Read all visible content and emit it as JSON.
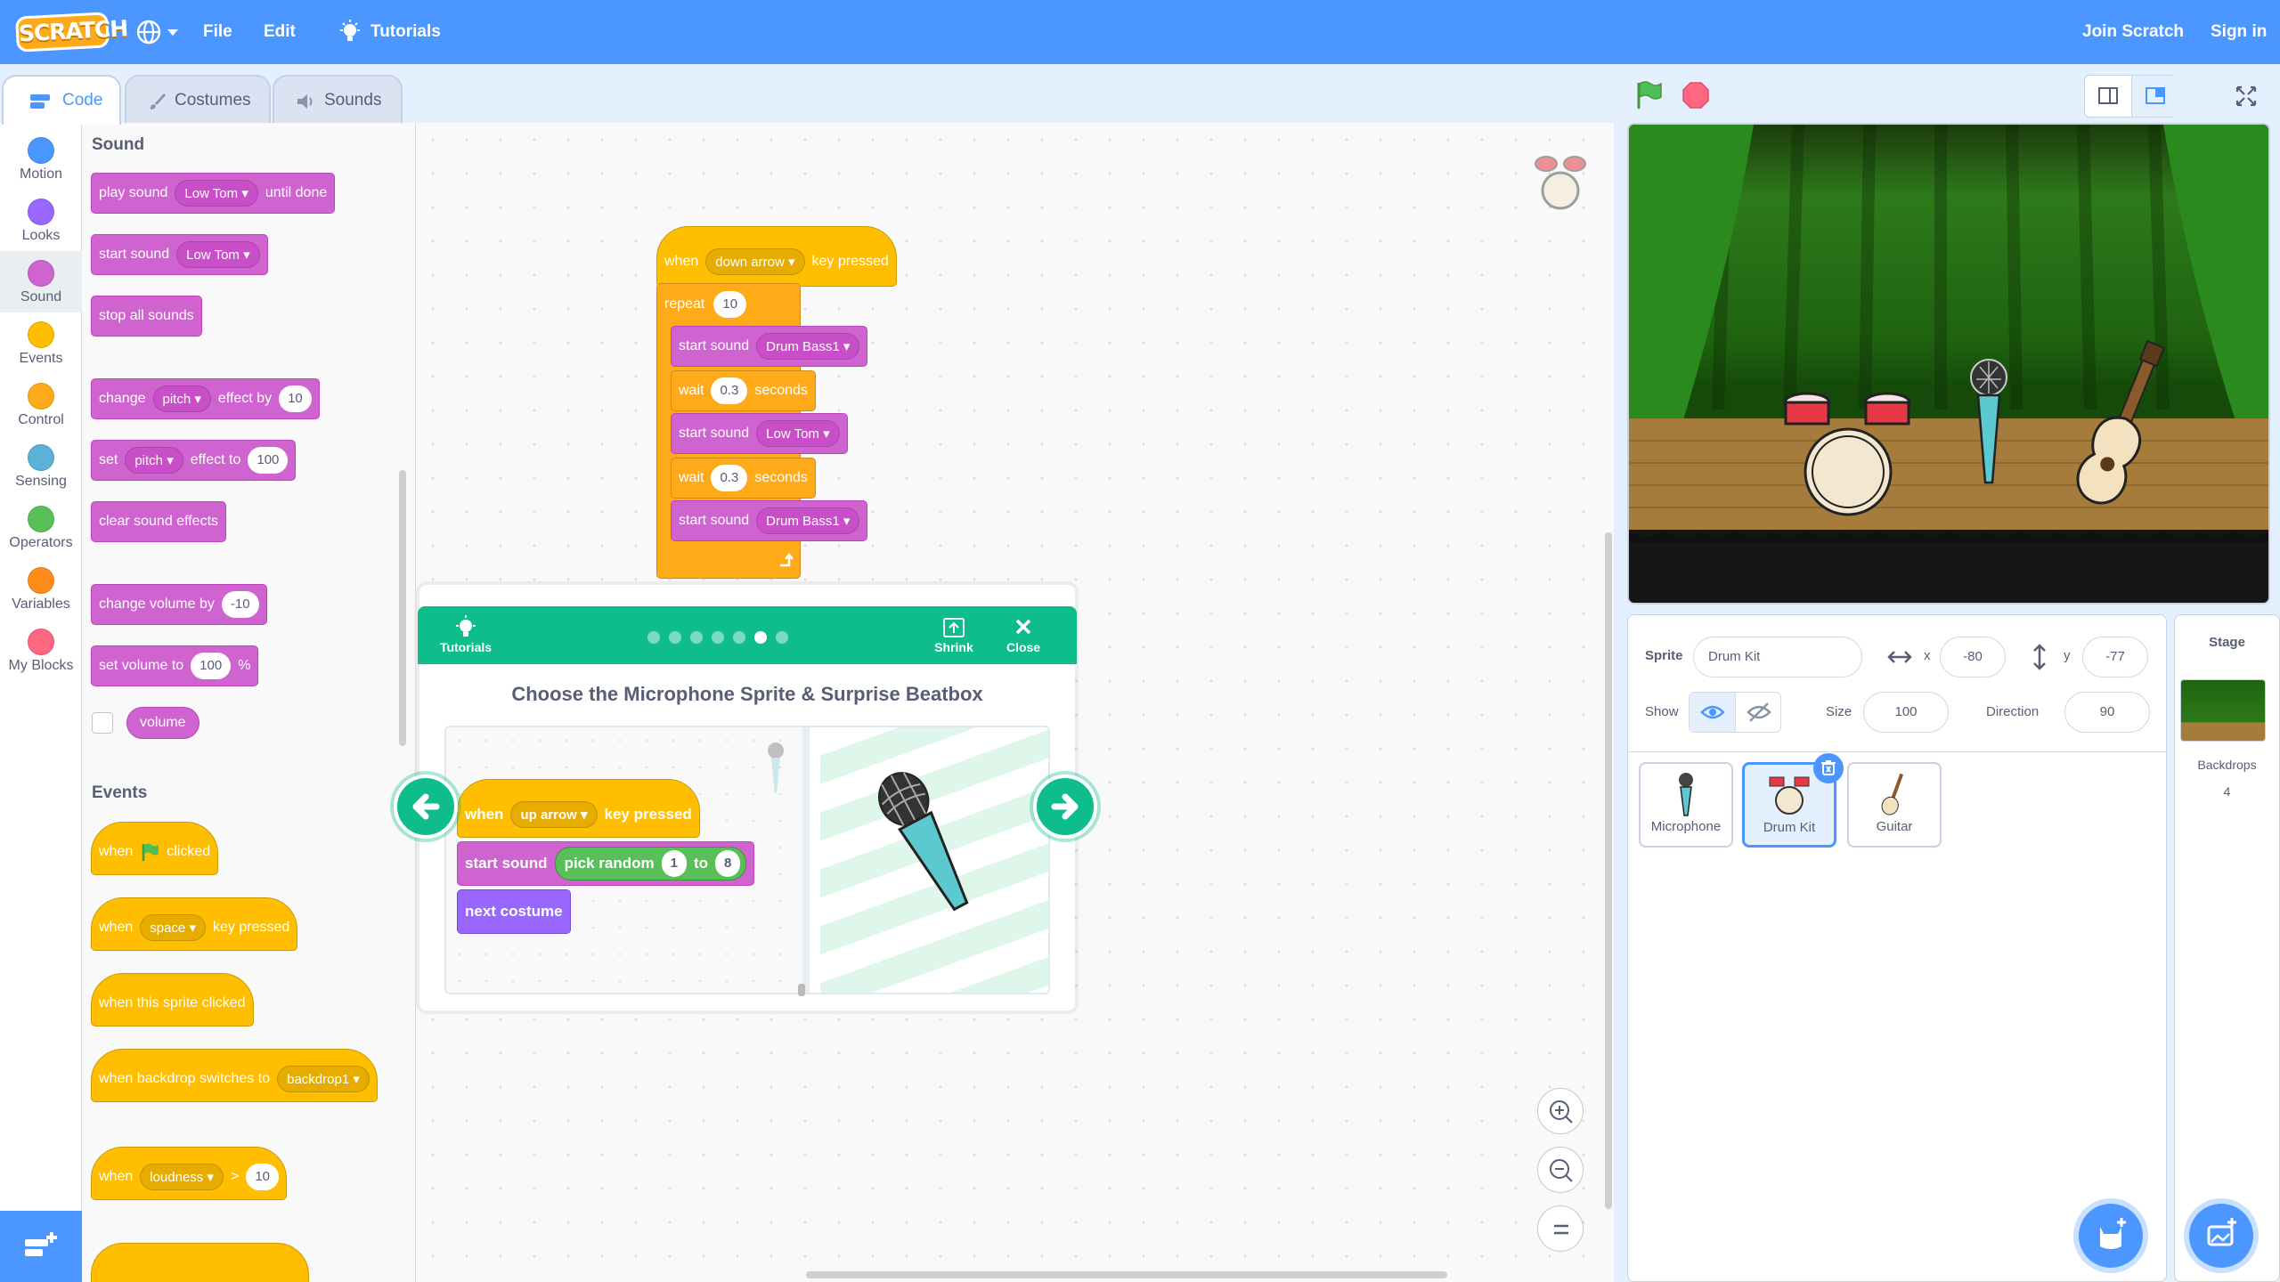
{
  "menu": {
    "file": "File",
    "edit": "Edit",
    "tutorials": "Tutorials",
    "join": "Join Scratch",
    "signin": "Sign in",
    "logo": "SCRATCH"
  },
  "tabs": {
    "code": "Code",
    "costumes": "Costumes",
    "sounds": "Sounds"
  },
  "categories": [
    {
      "label": "Motion",
      "color": "#4c97ff"
    },
    {
      "label": "Looks",
      "color": "#9966ff"
    },
    {
      "label": "Sound",
      "color": "#cf63cf"
    },
    {
      "label": "Events",
      "color": "#ffbf00"
    },
    {
      "label": "Control",
      "color": "#ffab19"
    },
    {
      "label": "Sensing",
      "color": "#5cb1d6"
    },
    {
      "label": "Operators",
      "color": "#59c059"
    },
    {
      "label": "Variables",
      "color": "#ff8c1a"
    },
    {
      "label": "My Blocks",
      "color": "#ff6680"
    }
  ],
  "palette": {
    "sound_title": "Sound",
    "play_sound": [
      "play sound",
      "Low Tom",
      "until done"
    ],
    "start_sound": [
      "start sound",
      "Low Tom"
    ],
    "stop_all": "stop all sounds",
    "change_effect": [
      "change",
      "pitch",
      "effect by",
      "10"
    ],
    "set_effect": [
      "set",
      "pitch",
      "effect to",
      "100"
    ],
    "clear_effects": "clear sound effects",
    "change_volume": [
      "change volume by",
      "-10"
    ],
    "set_volume": [
      "set volume to",
      "100",
      "%"
    ],
    "volume": "volume",
    "events_title": "Events",
    "when_flag": [
      "when",
      "clicked"
    ],
    "when_key": [
      "when",
      "space",
      "key pressed"
    ],
    "when_sprite": "when this sprite clicked",
    "when_backdrop": [
      "when backdrop switches to",
      "backdrop1"
    ],
    "when_loudness": [
      "when",
      "loudness",
      ">",
      "10"
    ]
  },
  "script": {
    "hat": [
      "when",
      "down arrow",
      "key pressed"
    ],
    "repeat": [
      "repeat",
      "10"
    ],
    "s1": [
      "start sound",
      "Drum Bass1"
    ],
    "w1": [
      "wait",
      "0.3",
      "seconds"
    ],
    "s2": [
      "start sound",
      "Low Tom"
    ],
    "w2": [
      "wait",
      "0.3",
      "seconds"
    ],
    "s3": [
      "start sound",
      "Drum Bass1"
    ]
  },
  "tutorial": {
    "header_label": "Tutorials",
    "shrink": "Shrink",
    "close": "Close",
    "title": "Choose the Microphone Sprite & Surprise Beatbox",
    "total_steps": 7,
    "current_step": 6,
    "code": {
      "hat": [
        "when",
        "up arrow",
        "key pressed"
      ],
      "start": [
        "start sound",
        "pick random",
        "1",
        "to",
        "8"
      ],
      "next": "next costume"
    }
  },
  "sprite_info": {
    "sprite_label": "Sprite",
    "name": "Drum Kit",
    "x_label": "x",
    "x": "-80",
    "y_label": "y",
    "y": "-77",
    "show_label": "Show",
    "size_label": "Size",
    "size": "100",
    "direction_label": "Direction",
    "direction": "90"
  },
  "sprites": [
    {
      "name": "Microphone"
    },
    {
      "name": "Drum Kit",
      "selected": true
    },
    {
      "name": "Guitar"
    }
  ],
  "stage_panel": {
    "title": "Stage",
    "backdrops_label": "Backdrops",
    "backdrops_count": "4"
  }
}
